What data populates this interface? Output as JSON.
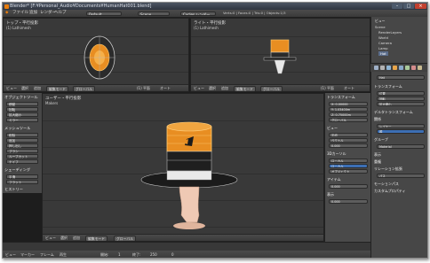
{
  "window": {
    "title": "Blender* [F:¥Personal_Audio¥Documents¥HumanHat001.blend]",
    "buttons": [
      "–",
      "□",
      "×"
    ]
  },
  "menubar": {
    "items": [
      "ファイル",
      "追加",
      "レンダー",
      "ヘルプ"
    ],
    "layout_field": "Default",
    "scene_field": "Scene",
    "render_engine": "Cycles レンダー",
    "stats": "Verts:0 | Faces:0 | Tris:0 | Objects:1/3"
  },
  "viewports": {
    "top_left": {
      "label": "トップ・平行投影",
      "sub": "(1) Lathimesh",
      "foot_label": "(1) 平面",
      "foot_value": "オート"
    },
    "top_right": {
      "label": "ライト・平行投影",
      "sub": "(1) Lathimesh",
      "foot_label": "(1) 平面",
      "foot_value": "オート"
    },
    "main": {
      "label": "ユーザー・平行投影",
      "sub": "Makers"
    }
  },
  "headers": {
    "view": "ビュー",
    "select": "選択",
    "add": "追加",
    "object": "オブジェクト",
    "mode": "編集モード",
    "global": "グローバル"
  },
  "tools_panel": {
    "sections": [
      "オブジェクトツール",
      "トランスフォーム",
      "メッシュツール",
      "シェーディング"
    ],
    "items": [
      "移動",
      "回転",
      "拡大縮小",
      "ミラー",
      "削除",
      "追加",
      "押し出し",
      "ブラシ",
      "ループカット",
      "ナイフ",
      "平滑",
      "フラット"
    ],
    "bottom": "ヒストリー"
  },
  "properties_panel": {
    "sections": [
      "トランスフォーム",
      "ビュー",
      "3Dカーソル",
      "アイテム",
      "表示"
    ],
    "fields": [
      "X: 0.00000",
      "Y: 1.03400m",
      "Z: 0.75000m",
      "グローバル",
      "ローカル",
      "平均",
      "ベクトル",
      "0.000"
    ],
    "toggles": [
      "ローカル",
      "オブジェクト"
    ]
  },
  "outliner": {
    "header": "ビュー",
    "items": [
      "Scene",
      "RenderLayers",
      "World",
      "Camera",
      "Lamp",
      "Hat"
    ]
  },
  "property_editor": {
    "object_name": "Hat",
    "sections": [
      "トランスフォーム",
      "デルタトランスフォーム",
      "関係",
      "グループ",
      "表示",
      "重複",
      "リレーション拡張",
      "モーションパス",
      "カスタムプロパティ"
    ],
    "fields": [
      "位置",
      "回転",
      "拡大縮小",
      "レイヤー",
      "親",
      "パス"
    ],
    "material_label": "Material"
  },
  "timeline": {
    "items": [
      "ビュー",
      "マーカー",
      "フレーム",
      "再生",
      "開始:",
      "1",
      "終了:",
      "250",
      "0"
    ]
  },
  "colors": {
    "accent": "#e87d0d",
    "ui_dark": "#1d1d1d",
    "viewport": "#393939",
    "panel": "#474747"
  }
}
